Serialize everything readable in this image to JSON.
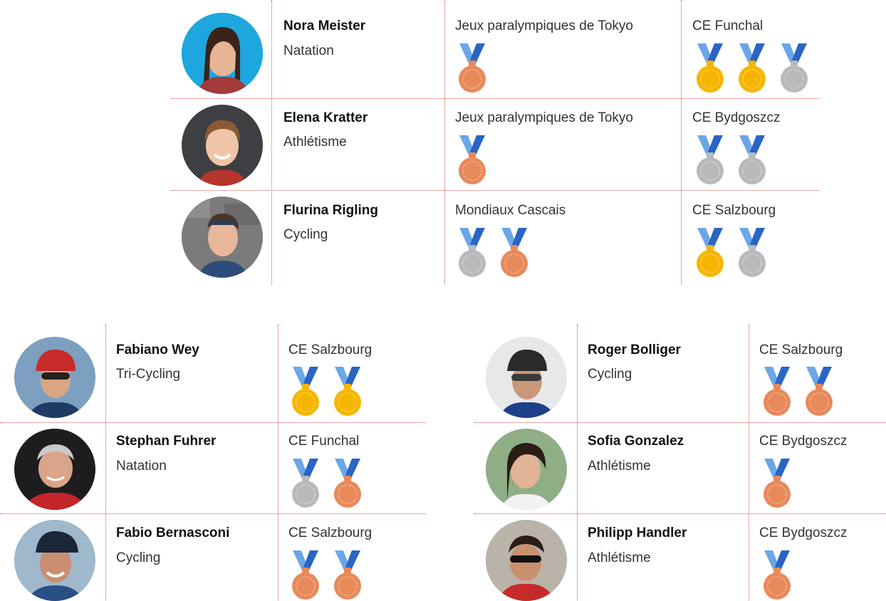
{
  "colors": {
    "ribbon_dark": "#2a64c4",
    "ribbon_light": "#6aa6e8",
    "gold": "#f6b600",
    "silver": "#b7b9bb",
    "bronze": "#e8895a",
    "divider": "#d9534f"
  },
  "top_table": {
    "rows": [
      {
        "avatar": "athlete-photo-nora",
        "name": "Nora Meister",
        "sport": "Natation",
        "event1": {
          "name": "Jeux paralympiques de Tokyo",
          "medals": [
            "bronze"
          ]
        },
        "event2": {
          "name": "CE Funchal",
          "medals": [
            "gold",
            "gold",
            "silver"
          ]
        }
      },
      {
        "avatar": "athlete-photo-elena",
        "name": "Elena Kratter",
        "sport": "Athlétisme",
        "event1": {
          "name": "Jeux paralympiques de Tokyo",
          "medals": [
            "bronze"
          ]
        },
        "event2": {
          "name": "CE Bydgoszcz",
          "medals": [
            "silver",
            "silver"
          ]
        }
      },
      {
        "avatar": "athlete-photo-flurina",
        "name": "Flurina Rigling",
        "sport": "Cycling",
        "event1": {
          "name": "Mondiaux Cascais",
          "medals": [
            "silver",
            "bronze"
          ]
        },
        "event2": {
          "name": "CE Salzbourg",
          "medals": [
            "gold",
            "silver"
          ]
        }
      }
    ]
  },
  "bottom_left_table": {
    "rows": [
      {
        "avatar": "athlete-photo-fabiano",
        "name": "Fabiano Wey",
        "sport": "Tri-Cycling",
        "event": {
          "name": "CE Salzbourg",
          "medals": [
            "gold",
            "gold"
          ]
        }
      },
      {
        "avatar": "athlete-photo-stephan",
        "name": "Stephan Fuhrer",
        "sport": "Natation",
        "event": {
          "name": "CE Funchal",
          "medals": [
            "silver",
            "bronze"
          ]
        }
      },
      {
        "avatar": "athlete-photo-fabio",
        "name": "Fabio Bernasconi",
        "sport": "Cycling",
        "event": {
          "name": "CE Salzbourg",
          "medals": [
            "bronze",
            "bronze"
          ]
        }
      }
    ]
  },
  "bottom_right_table": {
    "rows": [
      {
        "avatar": "athlete-photo-roger",
        "name": "Roger Bolliger",
        "sport": "Cycling",
        "event": {
          "name": "CE Salzbourg",
          "medals": [
            "bronze",
            "bronze"
          ]
        }
      },
      {
        "avatar": "athlete-photo-sofia",
        "name": "Sofia Gonzalez",
        "sport": "Athlétisme",
        "event": {
          "name": "CE Bydgoszcz",
          "medals": [
            "bronze"
          ]
        }
      },
      {
        "avatar": "athlete-photo-philipp",
        "name": "Philipp Handler",
        "sport": "Athlétisme",
        "event": {
          "name": "CE Bydgoszcz",
          "medals": [
            "bronze"
          ]
        }
      }
    ]
  }
}
